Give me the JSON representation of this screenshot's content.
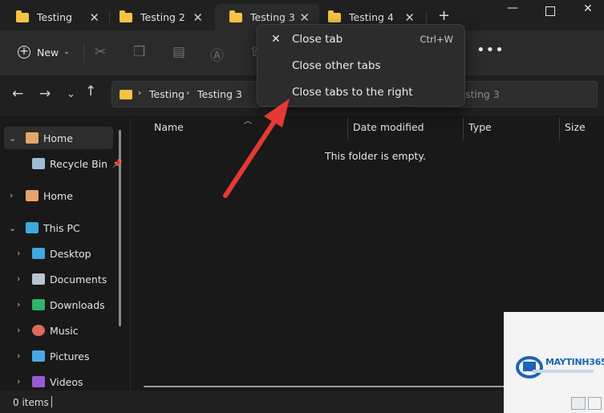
{
  "tabs": [
    {
      "label": "Testing"
    },
    {
      "label": "Testing 2"
    },
    {
      "label": "Testing 3"
    },
    {
      "label": "Testing 4"
    }
  ],
  "toolbar": {
    "new_label": "New"
  },
  "address": {
    "crumbs": [
      "Testing",
      "Testing 3"
    ],
    "search_placeholder": "Search Testing 3"
  },
  "sidebar": {
    "items": [
      {
        "label": "Home"
      },
      {
        "label": "Recycle Bin"
      },
      {
        "label": "Home"
      },
      {
        "label": "This PC"
      },
      {
        "label": "Desktop"
      },
      {
        "label": "Documents"
      },
      {
        "label": "Downloads"
      },
      {
        "label": "Music"
      },
      {
        "label": "Pictures"
      },
      {
        "label": "Videos"
      }
    ]
  },
  "columns": {
    "name": "Name",
    "date_modified": "Date modified",
    "type": "Type",
    "size": "Size"
  },
  "content": {
    "empty_message": "This folder is empty."
  },
  "status": {
    "items": "0 items"
  },
  "context_menu": {
    "items": [
      {
        "label": "Close tab",
        "shortcut": "Ctrl+W"
      },
      {
        "label": "Close other tabs"
      },
      {
        "label": "Close tabs to the right"
      }
    ]
  },
  "watermark": {
    "brand": "MAYTINH365"
  },
  "colors": {
    "accent": "#e53935",
    "folder": "#f5c443",
    "background": "#191919"
  }
}
